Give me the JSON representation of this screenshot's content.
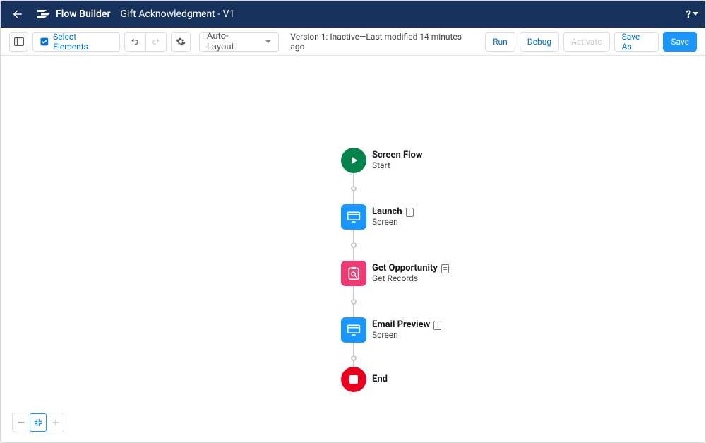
{
  "header": {
    "builder_name": "Flow Builder",
    "flow_title": "Gift Acknowledgment - V1"
  },
  "toolbar": {
    "select_elements": "Select Elements",
    "layout_mode": "Auto-Layout",
    "status": "Version 1: Inactive—Last modified 14 minutes ago",
    "run": "Run",
    "debug": "Debug",
    "activate": "Activate",
    "save_as": "Save As",
    "save": "Save"
  },
  "nodes": {
    "start": {
      "title": "Screen Flow",
      "sub": "Start"
    },
    "launch": {
      "title": "Launch",
      "sub": "Screen"
    },
    "get_opportunity": {
      "title": "Get Opportunity",
      "sub": "Get Records"
    },
    "email_preview": {
      "title": "Email Preview",
      "sub": "Screen"
    },
    "end": {
      "title": "End"
    }
  }
}
